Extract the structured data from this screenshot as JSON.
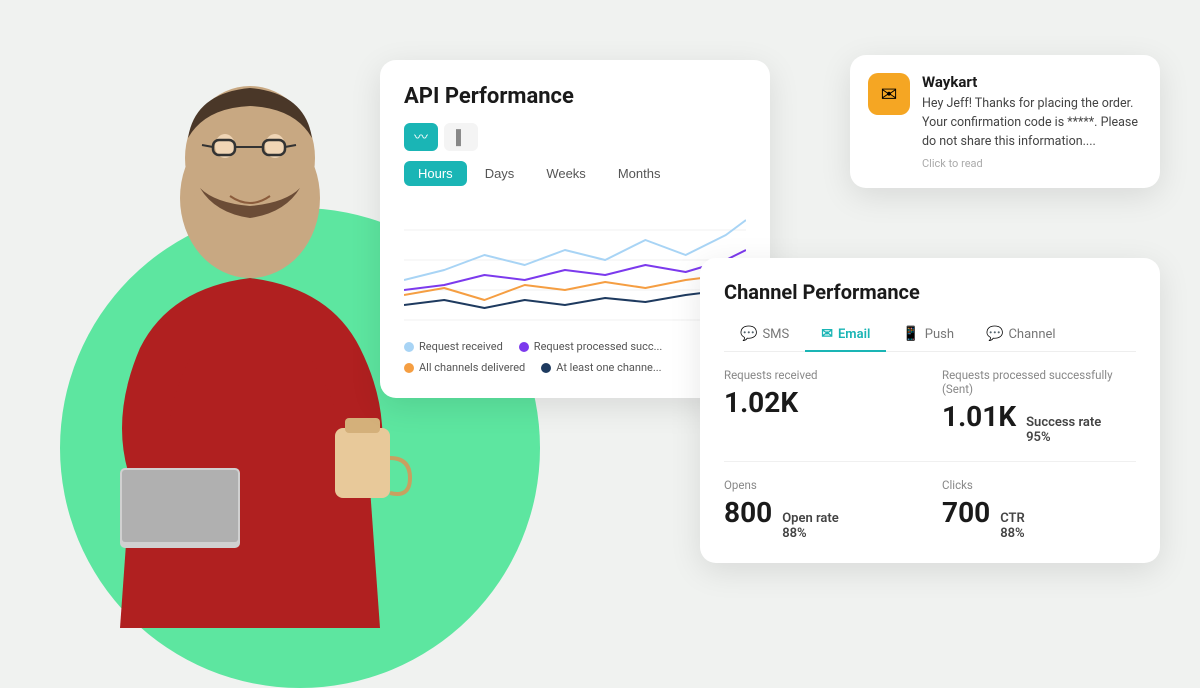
{
  "background": {
    "circle_color": "#5de6a0"
  },
  "api_card": {
    "title": "API Performance",
    "toggle_buttons": [
      {
        "id": "line",
        "icon": "〰",
        "active": true
      },
      {
        "id": "bar",
        "icon": "▐",
        "active": false
      }
    ],
    "time_tabs": [
      {
        "label": "Hours",
        "active": true
      },
      {
        "label": "Days",
        "active": false
      },
      {
        "label": "Weeks",
        "active": false
      },
      {
        "label": "Months",
        "active": false
      }
    ],
    "legend": [
      {
        "color": "#a8d4f5",
        "label": "Request received"
      },
      {
        "color": "#7c3aed",
        "label": "Request processed succ..."
      },
      {
        "color": "#f59e42",
        "label": "All channels delivered"
      },
      {
        "color": "#1e3a5f",
        "label": "At least one channe..."
      }
    ]
  },
  "notification_card": {
    "sender": "Waykart",
    "icon_emoji": "✉",
    "icon_bg": "#f5a623",
    "body": "Hey Jeff! Thanks for placing the order. Your confirmation code is *****. Please do not share this information....",
    "cta": "Click to read"
  },
  "channel_card": {
    "title": "Channel Performance",
    "tabs": [
      {
        "label": "SMS",
        "icon": "💬",
        "active": false
      },
      {
        "label": "Email",
        "icon": "✉",
        "active": true
      },
      {
        "label": "Push",
        "icon": "📱",
        "active": false
      },
      {
        "label": "Channel",
        "icon": "💬",
        "active": false
      }
    ],
    "metrics": [
      {
        "label": "Requests received",
        "value": "1.02K",
        "sub_label": "",
        "sub_value": ""
      },
      {
        "label": "Requests processed successfully (Sent)",
        "value": "1.01K",
        "sub_label": "Success rate",
        "sub_value": "95%"
      },
      {
        "label": "Opens",
        "value": "800",
        "sub_label": "Open rate",
        "sub_value": "88%"
      },
      {
        "label": "Clicks",
        "value": "700",
        "sub_label": "CTR",
        "sub_value": "88%"
      }
    ]
  }
}
